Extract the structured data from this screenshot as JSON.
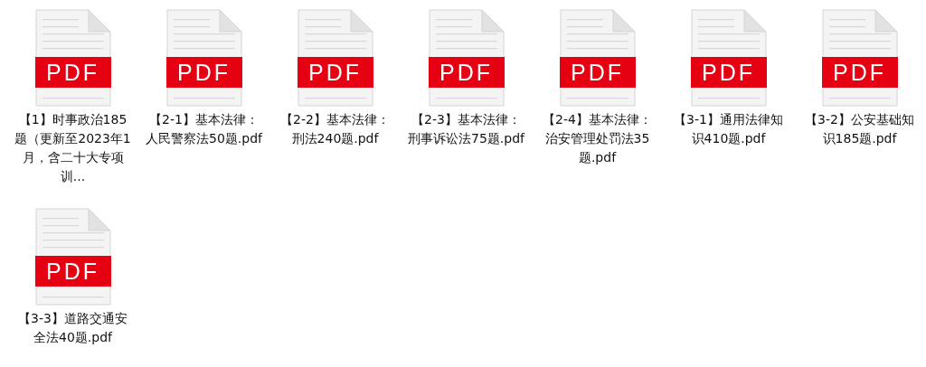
{
  "files": [
    {
      "badge": "PDF",
      "name": "【1】时事政治185题（更新至2023年1月，含二十大专项训..."
    },
    {
      "badge": "PDF",
      "name": "【2-1】基本法律：人民警察法50题.pdf"
    },
    {
      "badge": "PDF",
      "name": "【2-2】基本法律：刑法240题.pdf"
    },
    {
      "badge": "PDF",
      "name": "【2-3】基本法律：刑事诉讼法75题.pdf"
    },
    {
      "badge": "PDF",
      "name": "【2-4】基本法律：治安管理处罚法35题.pdf"
    },
    {
      "badge": "PDF",
      "name": "【3-1】通用法律知识410题.pdf"
    },
    {
      "badge": "PDF",
      "name": "【3-2】公安基础知识185题.pdf"
    },
    {
      "badge": "PDF",
      "name": "【3-3】道路交通安全法40题.pdf"
    }
  ]
}
